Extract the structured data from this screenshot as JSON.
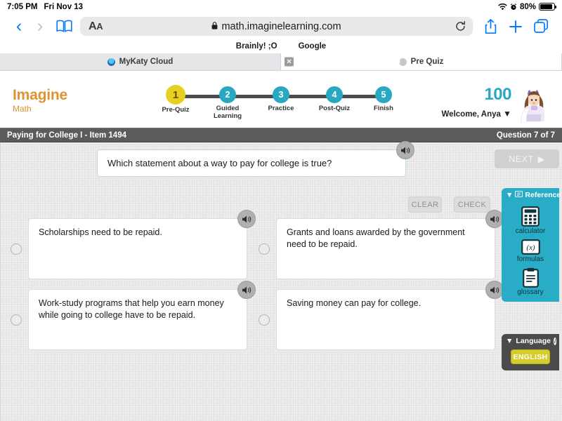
{
  "status_bar": {
    "time": "7:05 PM",
    "date": "Fri Nov 13",
    "battery_percent": "80%",
    "wifi_icon": "wifi-icon",
    "alarm_icon": "alarm-icon",
    "battery_icon": "battery-icon"
  },
  "browser": {
    "back_icon": "back-chevron-icon",
    "forward_icon": "forward-chevron-icon",
    "bookmarks_icon": "book-icon",
    "text_size_label": "AA",
    "lock_icon": "lock-icon",
    "url": "math.imaginelearning.com",
    "reload_icon": "reload-icon",
    "share_icon": "share-icon",
    "newtab_icon": "plus-icon",
    "tabs_icon": "tab-overview-icon",
    "bookmarks": [
      {
        "label": "Brainly! ;O"
      },
      {
        "label": "Google"
      }
    ],
    "tabs": [
      {
        "label": "MyKaty Cloud",
        "favicon": "mykaty-favicon",
        "active": false,
        "close_icon": "close-icon"
      },
      {
        "label": "Pre Quiz",
        "favicon": "prequiz-favicon",
        "favicon_letter": "I",
        "active": true
      }
    ]
  },
  "app_header": {
    "logo_line1": "Imagine",
    "logo_line2": "Math",
    "logo_color": "#e09232",
    "accent_color": "#29a8c1",
    "current_step_color": "#e8d022",
    "score": "100",
    "welcome": "Welcome, Anya",
    "welcome_caret": "▼",
    "avatar_icon": "student-avatar",
    "steps": [
      {
        "number": "1",
        "label": "Pre-Quiz",
        "state": "current"
      },
      {
        "number": "2",
        "label": "Guided\nLearning",
        "state": "upcoming"
      },
      {
        "number": "3",
        "label": "Practice",
        "state": "upcoming"
      },
      {
        "number": "4",
        "label": "Post-Quiz",
        "state": "upcoming"
      },
      {
        "number": "5",
        "label": "Finish",
        "state": "upcoming"
      }
    ]
  },
  "lesson_bar": {
    "title": "Paying for College I - Item 1494",
    "question_counter": "Question 7 of 7"
  },
  "question": {
    "text": "Which statement about a way to pay for college is true?",
    "speaker_icon": "speaker-icon"
  },
  "controls": {
    "clear_label": "CLEAR",
    "check_label": "CHECK",
    "next_label": "NEXT",
    "next_arrow": "▶"
  },
  "answers": [
    {
      "text": "Scholarships need to be repaid.",
      "selected": false,
      "speaker_icon": "speaker-icon"
    },
    {
      "text": "Grants and loans awarded by the government need to be repaid.",
      "selected": false,
      "speaker_icon": "speaker-icon"
    },
    {
      "text": "Work-study programs that help you earn money while going to college have to be repaid.",
      "selected": false,
      "speaker_icon": "speaker-icon"
    },
    {
      "text": "Saving money can pay for college.",
      "selected": false,
      "speaker_icon": "speaker-icon"
    }
  ],
  "reference_panel": {
    "title": "Reference",
    "collapse_icon": "▼",
    "header_icon": "reference-book-icon",
    "tools": [
      {
        "label": "calculator",
        "icon": "calculator-icon"
      },
      {
        "label": "formulas",
        "icon": "formulas-icon"
      },
      {
        "label": "glossary",
        "icon": "glossary-clipboard-icon"
      }
    ]
  },
  "language_panel": {
    "title": "Language",
    "collapse_icon": "▼",
    "info_icon": "info-icon",
    "current_language": "ENGLISH"
  }
}
